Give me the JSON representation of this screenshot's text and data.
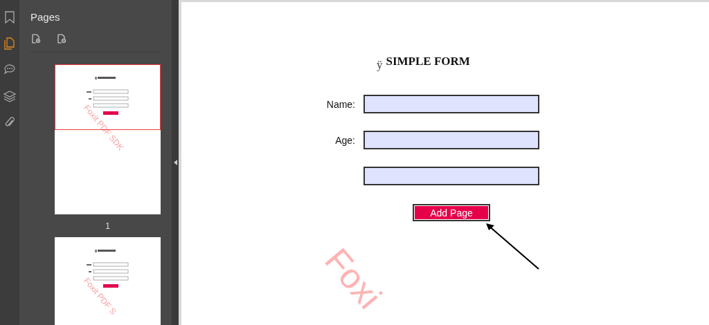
{
  "rail": [
    {
      "kind": "bookmark",
      "selected": false
    },
    {
      "kind": "pages",
      "selected": true
    },
    {
      "kind": "comments",
      "selected": false
    },
    {
      "kind": "layers",
      "selected": false
    },
    {
      "kind": "attachment",
      "selected": false
    }
  ],
  "pages_panel": {
    "title": "Pages",
    "tools": [
      {
        "kind": "zoom-in"
      },
      {
        "kind": "zoom-out"
      }
    ],
    "thumbnails": [
      {
        "label": "1",
        "selected": true,
        "watermark": "Foxit PDF SDK"
      },
      {
        "selected": false,
        "watermark": "Foxit PDF S"
      }
    ]
  },
  "document": {
    "title_mark": "ÿ",
    "title": "SIMPLE FORM",
    "fields": [
      {
        "kind": "text",
        "label": "Name:"
      },
      {
        "kind": "text",
        "label": "Age:"
      },
      {
        "kind": "text"
      }
    ],
    "button": "Add Page",
    "watermark": "Foxi"
  }
}
